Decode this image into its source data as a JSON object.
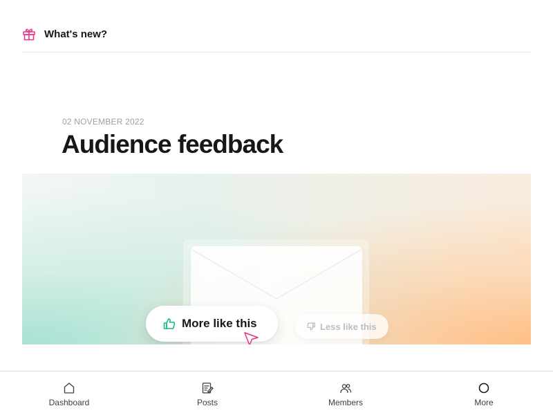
{
  "header": {
    "title": "What's new?",
    "icon": "gift-icon",
    "icon_color": "#e8308a"
  },
  "article": {
    "date": "02 NOVEMBER 2022",
    "title": "Audience feedback"
  },
  "banner": {
    "more_button_label": "More like this",
    "less_button_label": "Less like this",
    "accent_green": "#14b886",
    "cursor_color": "#e8308a"
  },
  "tabbar": {
    "items": [
      {
        "label": "Dashboard",
        "icon": "home-icon"
      },
      {
        "label": "Posts",
        "icon": "posts-icon"
      },
      {
        "label": "Members",
        "icon": "members-icon"
      },
      {
        "label": "More",
        "icon": "circle-icon"
      }
    ]
  }
}
